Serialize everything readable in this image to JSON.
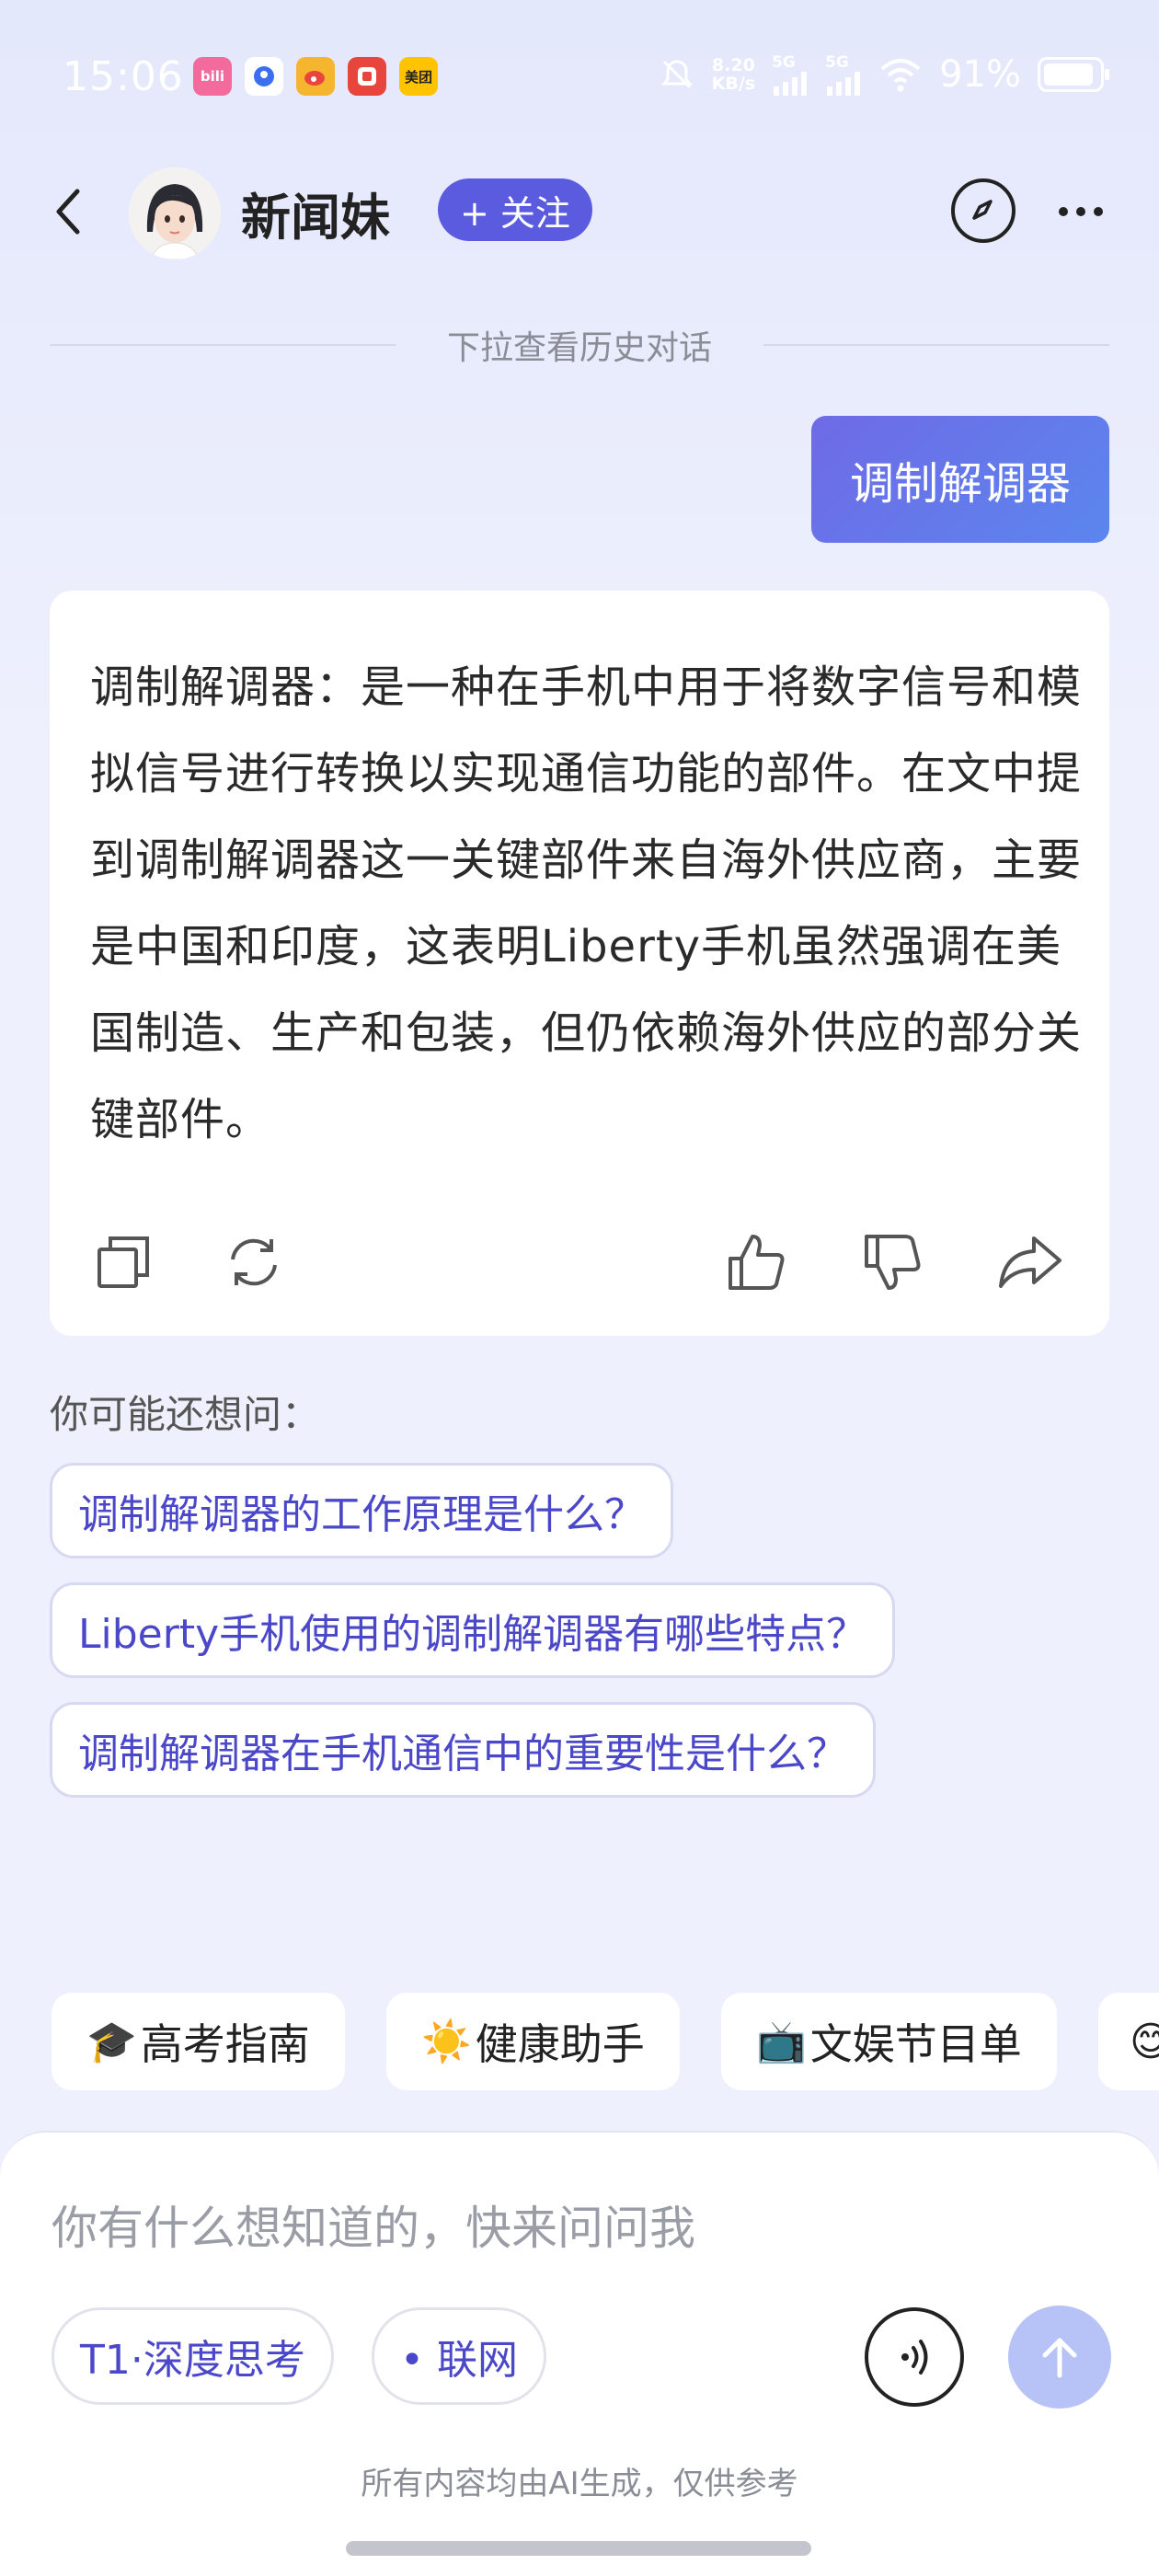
{
  "status_bar": {
    "time": "15:06",
    "apps": [
      {
        "name": "bilibili-app-icon",
        "label": "bili",
        "color": "#f26b9c"
      },
      {
        "name": "baidu-app-icon",
        "label": "",
        "color": "#3b6ef0"
      },
      {
        "name": "weibo-app-icon",
        "label": "",
        "color": "#f6b52f"
      },
      {
        "name": "xiaohongshu-app-icon",
        "label": "",
        "color": "#e8453c"
      },
      {
        "name": "meituan-app-icon",
        "label": "美团",
        "color": "#ffc300"
      }
    ],
    "net_speed_value": "8.20",
    "net_speed_unit": "KB/s",
    "signal_1": "5G",
    "signal_2": "5G",
    "battery_text": "91%",
    "battery_level": 0.91
  },
  "header": {
    "bot_name": "新闻妹",
    "follow_label": "+ 关注"
  },
  "history_hint": "下拉查看历史对话",
  "user_message": "调制解调器",
  "answer": {
    "text": "调制解调器：是一种在手机中用于将数字信号和模拟信号进行转换以实现通信功能的部件。在文中提到调制解调器这一关键部件来自海外供应商，主要是中国和印度，这表明Liberty手机虽然强调在美国制造、生产和包装，但仍依赖海外供应的部分关键部件。"
  },
  "suggestions": {
    "title": "你可能还想问：",
    "items": [
      "调制解调器的工作原理是什么？",
      "Liberty手机使用的调制解调器有哪些特点？",
      "调制解调器在手机通信中的重要性是什么？"
    ]
  },
  "shortcuts": [
    {
      "emoji": "🎓",
      "label": "高考指南"
    },
    {
      "emoji": "☀️",
      "label": "健康助手"
    },
    {
      "emoji": "📺",
      "label": "文娱节目单"
    },
    {
      "emoji": "😊",
      "label": ""
    }
  ],
  "input": {
    "placeholder": "你有什么想知道的，快来问问我",
    "deep_think_label": "T1·深度思考",
    "web_label": "• 联网",
    "disclaimer": "所有内容均由AI生成，仅供参考"
  },
  "colors": {
    "accent": "#5b5be0",
    "send_disabled": "#b7c3f6"
  }
}
